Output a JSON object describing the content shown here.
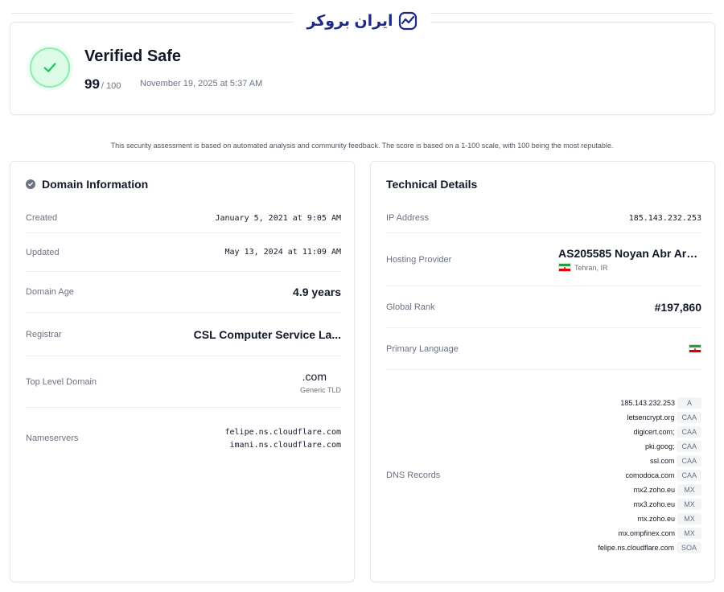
{
  "brand": {
    "name": "ایران بروکر",
    "icon": "brand-chart-icon"
  },
  "hero": {
    "status_title": "Verified Safe",
    "score": "99",
    "score_max": "/ 100",
    "date": "November 19, 2025 at 5:37 AM",
    "icon": "check-icon",
    "accent_color": "#22c55e"
  },
  "disclaimer": "This security assessment is based on automated analysis and community feedback. The score is based on a 1-100 scale, with 100 being the most reputable.",
  "domain_info": {
    "title": "Domain Information",
    "rows": [
      {
        "label": "Created",
        "value": "January 5, 2021 at 9:05 AM"
      },
      {
        "label": "Updated",
        "value": "May 13, 2024 at 11:09 AM"
      },
      {
        "label": "Domain Age",
        "value": "4.9 years"
      },
      {
        "label": "Registrar",
        "value": "CSL Computer Service La..."
      },
      {
        "label": "Top Level Domain",
        "value": ".com",
        "sub": "Generic TLD"
      },
      {
        "label": "Nameservers",
        "values": [
          "felipe.ns.cloudflare.com",
          "imani.ns.cloudflare.com"
        ]
      }
    ]
  },
  "technical": {
    "title": "Technical Details",
    "ip": {
      "label": "IP Address",
      "value": "185.143.232.253"
    },
    "hosting": {
      "label": "Hosting Provider",
      "value": "AS205585 Noyan Abr Arva...",
      "location": "Tehran, IR"
    },
    "rank": {
      "label": "Global Rank",
      "value": "#197,860"
    },
    "language": {
      "label": "Primary Language",
      "flag": "iran-flag-icon"
    },
    "dns": {
      "label": "DNS Records",
      "records": [
        {
          "value": "185.143.232.253",
          "type": "A"
        },
        {
          "value": "letsencrypt.org",
          "type": "CAA"
        },
        {
          "value": "digicert.com;",
          "type": "CAA"
        },
        {
          "value": "pki.goog;",
          "type": "CAA"
        },
        {
          "value": "ssl.com",
          "type": "CAA"
        },
        {
          "value": "comodoca.com",
          "type": "CAA"
        },
        {
          "value": "mx2.zoho.eu",
          "type": "MX"
        },
        {
          "value": "mx3.zoho.eu",
          "type": "MX"
        },
        {
          "value": "mx.zoho.eu",
          "type": "MX"
        },
        {
          "value": "mx.ompfinex.com",
          "type": "MX"
        },
        {
          "value": "felipe.ns.cloudflare.com",
          "type": "SOA"
        }
      ]
    }
  }
}
